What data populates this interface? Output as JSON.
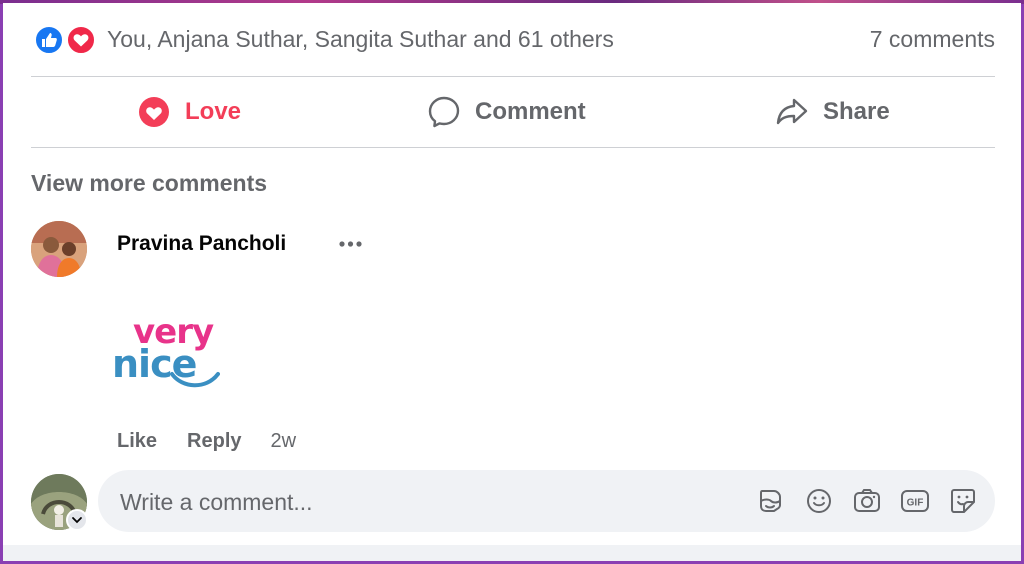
{
  "reactions": {
    "summary": "You, Anjana Suthar, Sangita Suthar and 61 others",
    "comments_count": "7 comments",
    "icons": [
      "thumbs-up-icon",
      "heart-icon"
    ],
    "colors": {
      "like": "#1877f2",
      "love": "#f02849"
    }
  },
  "actions": {
    "love_label": "Love",
    "comment_label": "Comment",
    "share_label": "Share",
    "love_color": "#f33e58"
  },
  "view_more": "View more comments",
  "comment": {
    "author": "Pravina Pancholi",
    "sticker": {
      "line1": "very",
      "line2": "nice"
    },
    "like_label": "Like",
    "reply_label": "Reply",
    "time": "2w"
  },
  "composer": {
    "placeholder": "Write a comment...",
    "icons": [
      "avatar-sticker-icon",
      "emoji-icon",
      "camera-icon",
      "gif-icon",
      "sticker-icon"
    ]
  }
}
